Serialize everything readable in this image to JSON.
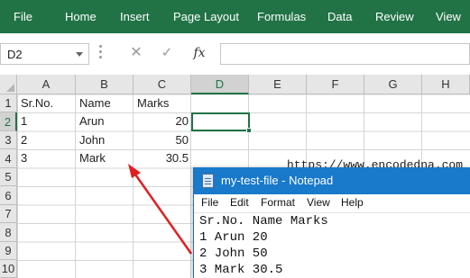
{
  "ribbon": {
    "tabs": [
      "File",
      "Home",
      "Insert",
      "Page Layout",
      "Formulas",
      "Data",
      "Review",
      "View"
    ],
    "color": "#217346"
  },
  "formula_bar": {
    "name_box": "D2",
    "cancel_icon": "cancel-icon",
    "enter_icon": "enter-icon",
    "fx_label": "fx",
    "formula_value": ""
  },
  "sheet": {
    "columns": [
      "A",
      "B",
      "C",
      "D",
      "E",
      "F",
      "G",
      "H"
    ],
    "rows": [
      "1",
      "2",
      "3",
      "4",
      "5",
      "6",
      "7",
      "8",
      "9",
      "10"
    ],
    "active_column": "D",
    "active_row": "2",
    "cells": {
      "A1": "Sr.No.",
      "B1": "Name",
      "C1": "Marks",
      "A2": "1",
      "B2": "Arun",
      "C2": "20",
      "A3": "2",
      "B3": "John",
      "C3": "50",
      "A4": "3",
      "B4": "Mark",
      "C4": "30.5"
    },
    "grid_color": "#d4d4d4"
  },
  "annotation": {
    "watermark": "https://www.encodedna.com",
    "arrow_color": "#e02020"
  },
  "notepad": {
    "title": "my-test-file - Notepad",
    "title_color": "#1979ca",
    "menu": [
      "File",
      "Edit",
      "Format",
      "View",
      "Help"
    ],
    "lines": [
      "Sr.No. Name Marks",
      "1 Arun 20",
      "2 John 50",
      "3 Mark 30.5"
    ]
  }
}
